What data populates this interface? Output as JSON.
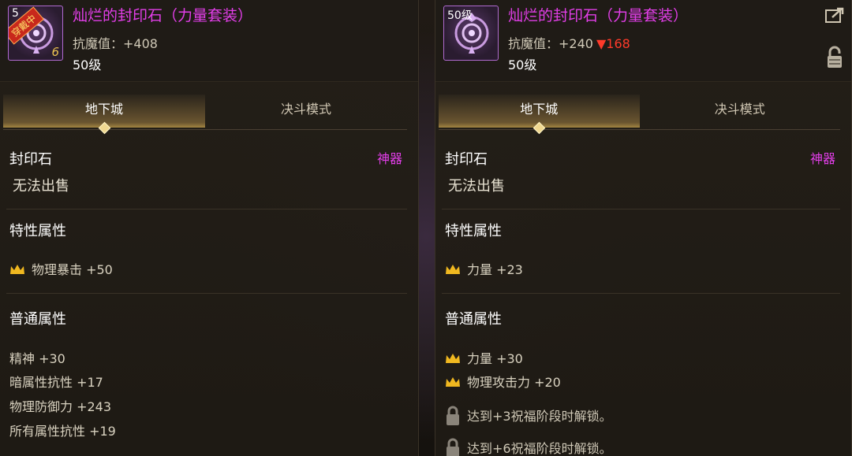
{
  "left_panel": {
    "icon": {
      "level": "5",
      "badge": "穿戴中",
      "enhance": "6"
    },
    "item_name": "灿烂的封印石（力量套装）",
    "attack_label": "抗魔值：",
    "attack_value": "+408",
    "level": "50级",
    "tabs": {
      "dungeon": "地下城",
      "duel": "决斗模式"
    },
    "category": "封印石",
    "rarity": "神器",
    "sale": "无法出售",
    "trait_title": "特性属性",
    "traits": [
      "物理暴击 +50"
    ],
    "normal_title": "普通属性",
    "normal_stats": [
      "精神 +30",
      "暗属性抗性 +17",
      "物理防御力 +243",
      "所有属性抗性 +19"
    ]
  },
  "right_panel": {
    "icon": {
      "level": "50级"
    },
    "item_name": "灿烂的封印石（力量套装）",
    "attack_label": "抗魔值：",
    "attack_value": "+240",
    "attack_diff": "▼168",
    "level": "50级",
    "tabs": {
      "dungeon": "地下城",
      "duel": "决斗模式"
    },
    "category": "封印石",
    "rarity": "神器",
    "sale": "无法出售",
    "trait_title": "特性属性",
    "traits": [
      "力量 +23"
    ],
    "normal_title": "普通属性",
    "normal_stats": [
      "力量 +30",
      "物理攻击力 +20"
    ],
    "locked": [
      "达到+3祝福阶段时解锁。",
      "达到+6祝福阶段时解锁。"
    ]
  },
  "colors": {
    "name": "#e23ee8",
    "decrease": "#ff3a2a",
    "crown": "#f0b820"
  },
  "icons": [
    "sealstone-icon",
    "crown-icon",
    "lock-icon",
    "share-icon"
  ]
}
